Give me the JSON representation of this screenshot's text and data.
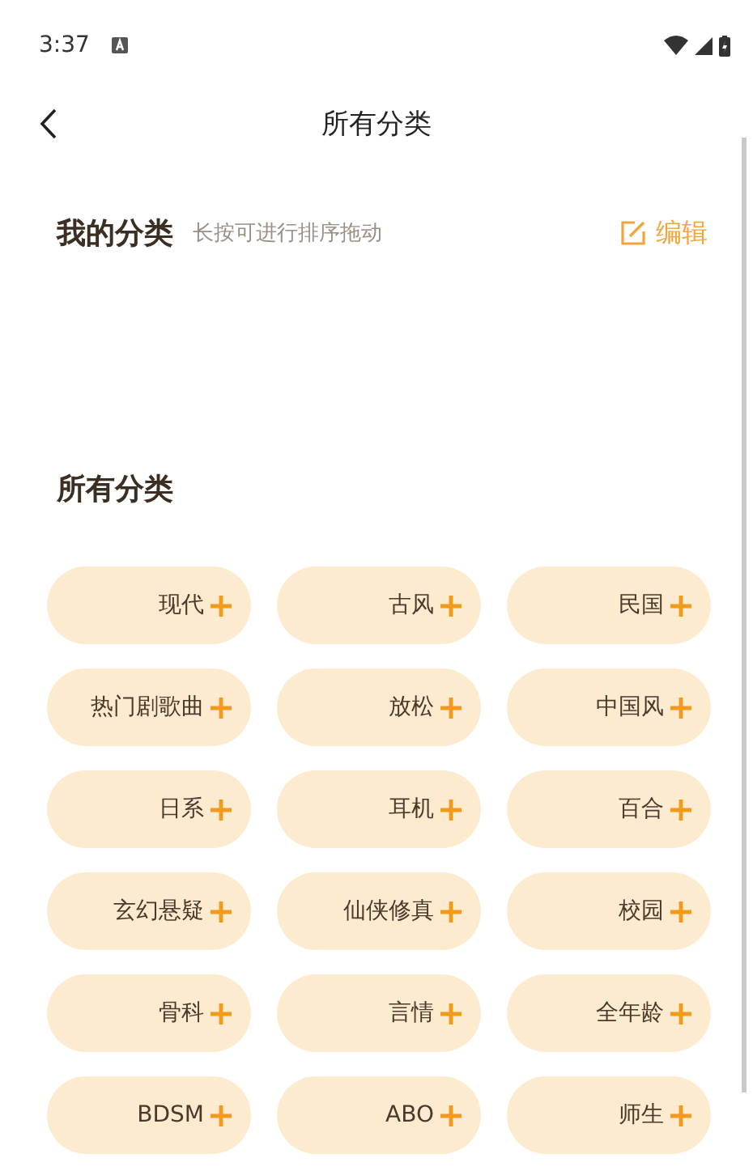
{
  "status_bar": {
    "time": "3:37"
  },
  "header": {
    "title": "所有分类"
  },
  "my_categories": {
    "title": "我的分类",
    "hint": "长按可进行排序拖动",
    "edit_label": "编辑"
  },
  "all_categories": {
    "title": "所有分类",
    "items": [
      {
        "label": "现代"
      },
      {
        "label": "古风"
      },
      {
        "label": "民国"
      },
      {
        "label": "热门剧歌曲"
      },
      {
        "label": "放松"
      },
      {
        "label": "中国风"
      },
      {
        "label": "日系"
      },
      {
        "label": "耳机"
      },
      {
        "label": "百合"
      },
      {
        "label": "玄幻悬疑"
      },
      {
        "label": "仙侠修真"
      },
      {
        "label": "校园"
      },
      {
        "label": "骨科"
      },
      {
        "label": "言情"
      },
      {
        "label": "全年龄"
      },
      {
        "label": "BDSM"
      },
      {
        "label": "ABO"
      },
      {
        "label": "师生"
      }
    ]
  }
}
